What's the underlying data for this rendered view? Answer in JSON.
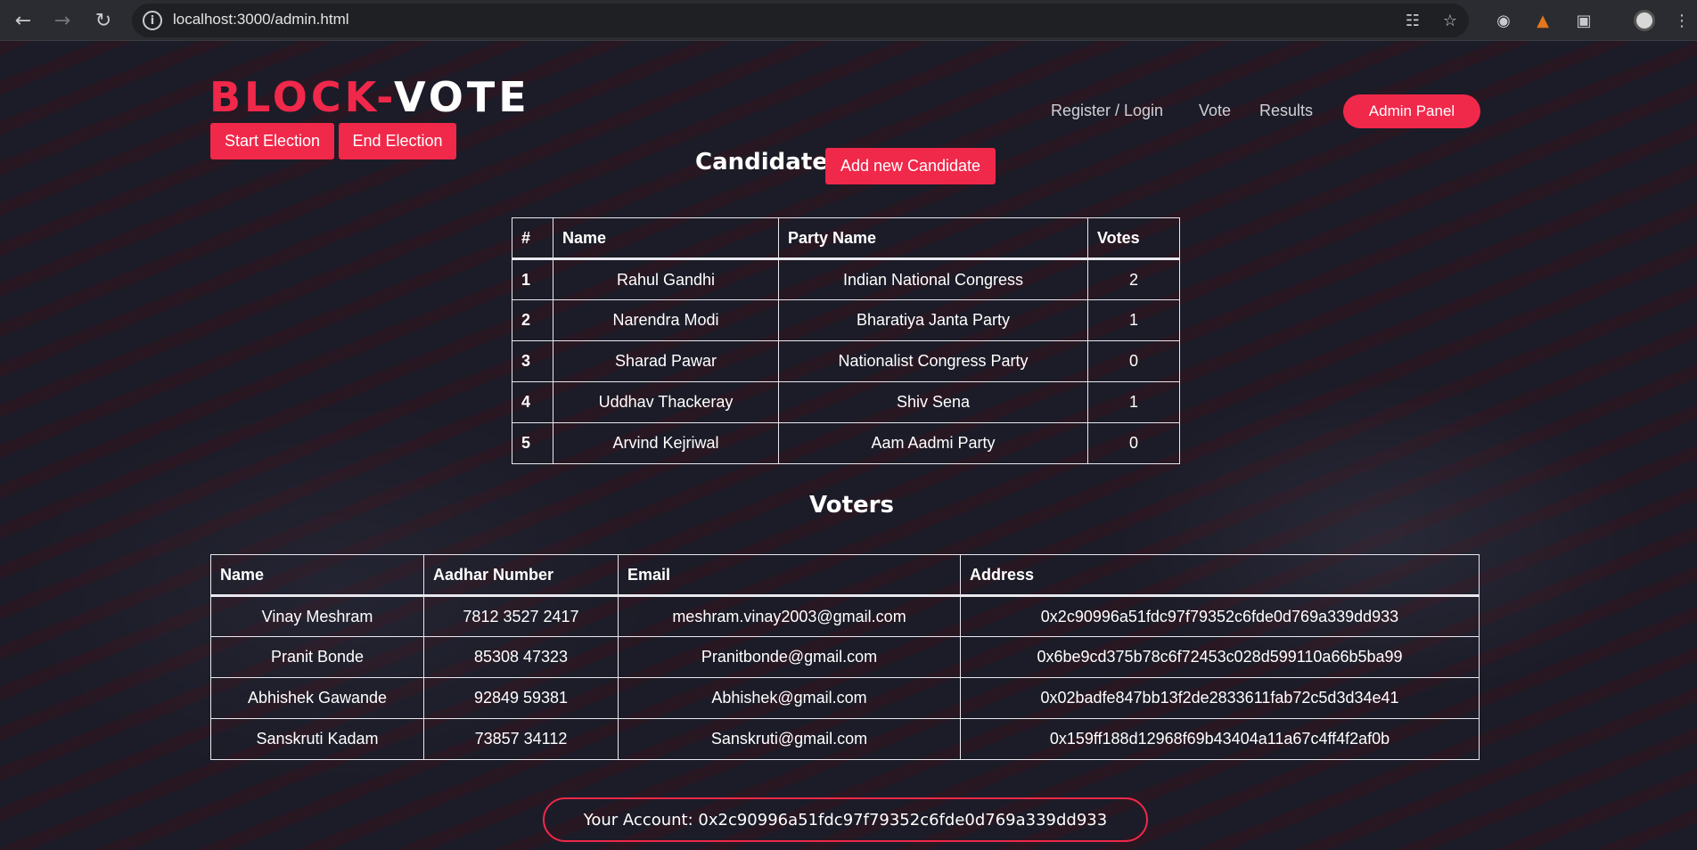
{
  "browser": {
    "url": "localhost:3000/admin.html"
  },
  "brand": {
    "part1": "BLOCK-",
    "part2": "VOTE"
  },
  "actions": {
    "start_election": "Start Election",
    "end_election": "End Election"
  },
  "nav": {
    "register_login": "Register / Login",
    "vote": "Vote",
    "results": "Results",
    "admin_panel": "Admin Panel"
  },
  "candidates": {
    "title": "Candidates",
    "add_button": "Add new Candidate",
    "headers": [
      "#",
      "Name",
      "Party Name",
      "Votes"
    ],
    "rows": [
      {
        "num": "1",
        "name": "Rahul Gandhi",
        "party": "Indian National Congress",
        "votes": "2"
      },
      {
        "num": "2",
        "name": "Narendra Modi",
        "party": "Bharatiya Janta Party",
        "votes": "1"
      },
      {
        "num": "3",
        "name": "Sharad Pawar",
        "party": "Nationalist Congress Party",
        "votes": "0"
      },
      {
        "num": "4",
        "name": "Uddhav Thackeray",
        "party": "Shiv Sena",
        "votes": "1"
      },
      {
        "num": "5",
        "name": "Arvind Kejriwal",
        "party": "Aam Aadmi Party",
        "votes": "0"
      }
    ]
  },
  "voters": {
    "title": "Voters",
    "headers": [
      "Name",
      "Aadhar Number",
      "Email",
      "Address"
    ],
    "rows": [
      {
        "name": "Vinay Meshram",
        "aadhar": "7812 3527 2417",
        "email": "meshram.vinay2003@gmail.com",
        "address": "0x2c90996a51fdc97f79352c6fde0d769a339dd933"
      },
      {
        "name": "Pranit Bonde",
        "aadhar": "85308 47323",
        "email": "Pranitbonde@gmail.com",
        "address": "0x6be9cd375b78c6f72453c028d599110a66b5ba99"
      },
      {
        "name": "Abhishek Gawande",
        "aadhar": "92849 59381",
        "email": "Abhishek@gmail.com",
        "address": "0x02badfe847bb13f2de2833611fab72c5d3d34e41"
      },
      {
        "name": "Sanskruti Kadam",
        "aadhar": "73857 34112",
        "email": "Sanskruti@gmail.com",
        "address": "0x159ff188d12968f69b43404a11a67c4ff4f2af0b"
      }
    ]
  },
  "account": {
    "text": "Your Account: 0x2c90996a51fdc97f79352c6fde0d769a339dd933"
  }
}
